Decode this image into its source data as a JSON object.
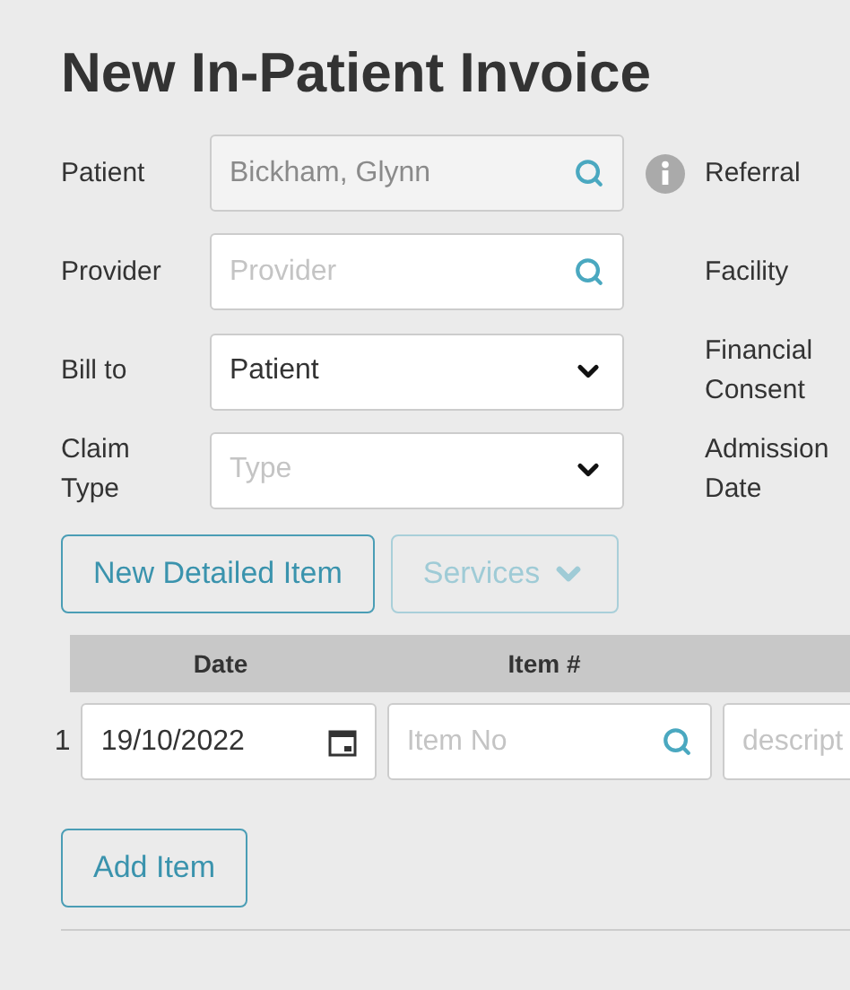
{
  "title": "New In-Patient Invoice",
  "form_rows": [
    {
      "label": "Patient",
      "field": {
        "kind": "search",
        "value": "Bickham, Glynn",
        "disabled": true
      },
      "info": true,
      "right_label": "Referral"
    },
    {
      "label": "Provider",
      "field": {
        "kind": "search",
        "placeholder": "Provider",
        "disabled": false
      },
      "info": false,
      "right_label": "Facility"
    },
    {
      "label": "Bill to",
      "field": {
        "kind": "select",
        "value": "Patient",
        "disabled": false
      },
      "info": false,
      "right_label": "Financial Consent"
    },
    {
      "label": "Claim Type",
      "field": {
        "kind": "select",
        "placeholder": "Type",
        "disabled": false
      },
      "info": false,
      "right_label": "Admission Date"
    }
  ],
  "actions": [
    {
      "label": "New Detailed Item",
      "disabled": false,
      "dropdown": false
    },
    {
      "label": "Services",
      "disabled": true,
      "dropdown": true
    }
  ],
  "table": {
    "columns": [
      "Date",
      "Item #"
    ],
    "rows": [
      {
        "number": "1",
        "date": "19/10/2022",
        "item_placeholder": "Item No",
        "description_placeholder": "descript"
      }
    ]
  },
  "add_button": "Add Item"
}
